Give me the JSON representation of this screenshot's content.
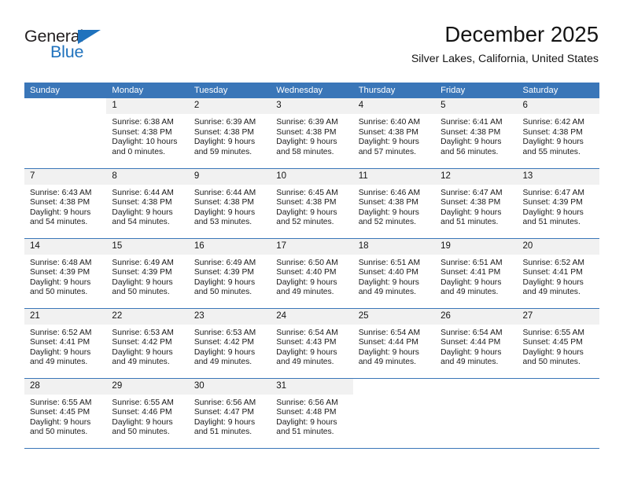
{
  "brand": {
    "name_part1": "General",
    "name_part2": "Blue",
    "triangle_color": "#1f72bd"
  },
  "header": {
    "title": "December 2025",
    "subtitle": "Silver Lakes, California, United States",
    "header_bg_color": "#3a76b8",
    "daynum_bg_color": "#f1f1f1"
  },
  "weekdays": [
    "Sunday",
    "Monday",
    "Tuesday",
    "Wednesday",
    "Thursday",
    "Friday",
    "Saturday"
  ],
  "weeks": [
    [
      {
        "day": "",
        "sunrise": "",
        "sunset": "",
        "daylight1": "",
        "daylight2": ""
      },
      {
        "day": "1",
        "sunrise": "Sunrise: 6:38 AM",
        "sunset": "Sunset: 4:38 PM",
        "daylight1": "Daylight: 10 hours",
        "daylight2": "and 0 minutes."
      },
      {
        "day": "2",
        "sunrise": "Sunrise: 6:39 AM",
        "sunset": "Sunset: 4:38 PM",
        "daylight1": "Daylight: 9 hours",
        "daylight2": "and 59 minutes."
      },
      {
        "day": "3",
        "sunrise": "Sunrise: 6:39 AM",
        "sunset": "Sunset: 4:38 PM",
        "daylight1": "Daylight: 9 hours",
        "daylight2": "and 58 minutes."
      },
      {
        "day": "4",
        "sunrise": "Sunrise: 6:40 AM",
        "sunset": "Sunset: 4:38 PM",
        "daylight1": "Daylight: 9 hours",
        "daylight2": "and 57 minutes."
      },
      {
        "day": "5",
        "sunrise": "Sunrise: 6:41 AM",
        "sunset": "Sunset: 4:38 PM",
        "daylight1": "Daylight: 9 hours",
        "daylight2": "and 56 minutes."
      },
      {
        "day": "6",
        "sunrise": "Sunrise: 6:42 AM",
        "sunset": "Sunset: 4:38 PM",
        "daylight1": "Daylight: 9 hours",
        "daylight2": "and 55 minutes."
      }
    ],
    [
      {
        "day": "7",
        "sunrise": "Sunrise: 6:43 AM",
        "sunset": "Sunset: 4:38 PM",
        "daylight1": "Daylight: 9 hours",
        "daylight2": "and 54 minutes."
      },
      {
        "day": "8",
        "sunrise": "Sunrise: 6:44 AM",
        "sunset": "Sunset: 4:38 PM",
        "daylight1": "Daylight: 9 hours",
        "daylight2": "and 54 minutes."
      },
      {
        "day": "9",
        "sunrise": "Sunrise: 6:44 AM",
        "sunset": "Sunset: 4:38 PM",
        "daylight1": "Daylight: 9 hours",
        "daylight2": "and 53 minutes."
      },
      {
        "day": "10",
        "sunrise": "Sunrise: 6:45 AM",
        "sunset": "Sunset: 4:38 PM",
        "daylight1": "Daylight: 9 hours",
        "daylight2": "and 52 minutes."
      },
      {
        "day": "11",
        "sunrise": "Sunrise: 6:46 AM",
        "sunset": "Sunset: 4:38 PM",
        "daylight1": "Daylight: 9 hours",
        "daylight2": "and 52 minutes."
      },
      {
        "day": "12",
        "sunrise": "Sunrise: 6:47 AM",
        "sunset": "Sunset: 4:38 PM",
        "daylight1": "Daylight: 9 hours",
        "daylight2": "and 51 minutes."
      },
      {
        "day": "13",
        "sunrise": "Sunrise: 6:47 AM",
        "sunset": "Sunset: 4:39 PM",
        "daylight1": "Daylight: 9 hours",
        "daylight2": "and 51 minutes."
      }
    ],
    [
      {
        "day": "14",
        "sunrise": "Sunrise: 6:48 AM",
        "sunset": "Sunset: 4:39 PM",
        "daylight1": "Daylight: 9 hours",
        "daylight2": "and 50 minutes."
      },
      {
        "day": "15",
        "sunrise": "Sunrise: 6:49 AM",
        "sunset": "Sunset: 4:39 PM",
        "daylight1": "Daylight: 9 hours",
        "daylight2": "and 50 minutes."
      },
      {
        "day": "16",
        "sunrise": "Sunrise: 6:49 AM",
        "sunset": "Sunset: 4:39 PM",
        "daylight1": "Daylight: 9 hours",
        "daylight2": "and 50 minutes."
      },
      {
        "day": "17",
        "sunrise": "Sunrise: 6:50 AM",
        "sunset": "Sunset: 4:40 PM",
        "daylight1": "Daylight: 9 hours",
        "daylight2": "and 49 minutes."
      },
      {
        "day": "18",
        "sunrise": "Sunrise: 6:51 AM",
        "sunset": "Sunset: 4:40 PM",
        "daylight1": "Daylight: 9 hours",
        "daylight2": "and 49 minutes."
      },
      {
        "day": "19",
        "sunrise": "Sunrise: 6:51 AM",
        "sunset": "Sunset: 4:41 PM",
        "daylight1": "Daylight: 9 hours",
        "daylight2": "and 49 minutes."
      },
      {
        "day": "20",
        "sunrise": "Sunrise: 6:52 AM",
        "sunset": "Sunset: 4:41 PM",
        "daylight1": "Daylight: 9 hours",
        "daylight2": "and 49 minutes."
      }
    ],
    [
      {
        "day": "21",
        "sunrise": "Sunrise: 6:52 AM",
        "sunset": "Sunset: 4:41 PM",
        "daylight1": "Daylight: 9 hours",
        "daylight2": "and 49 minutes."
      },
      {
        "day": "22",
        "sunrise": "Sunrise: 6:53 AM",
        "sunset": "Sunset: 4:42 PM",
        "daylight1": "Daylight: 9 hours",
        "daylight2": "and 49 minutes."
      },
      {
        "day": "23",
        "sunrise": "Sunrise: 6:53 AM",
        "sunset": "Sunset: 4:42 PM",
        "daylight1": "Daylight: 9 hours",
        "daylight2": "and 49 minutes."
      },
      {
        "day": "24",
        "sunrise": "Sunrise: 6:54 AM",
        "sunset": "Sunset: 4:43 PM",
        "daylight1": "Daylight: 9 hours",
        "daylight2": "and 49 minutes."
      },
      {
        "day": "25",
        "sunrise": "Sunrise: 6:54 AM",
        "sunset": "Sunset: 4:44 PM",
        "daylight1": "Daylight: 9 hours",
        "daylight2": "and 49 minutes."
      },
      {
        "day": "26",
        "sunrise": "Sunrise: 6:54 AM",
        "sunset": "Sunset: 4:44 PM",
        "daylight1": "Daylight: 9 hours",
        "daylight2": "and 49 minutes."
      },
      {
        "day": "27",
        "sunrise": "Sunrise: 6:55 AM",
        "sunset": "Sunset: 4:45 PM",
        "daylight1": "Daylight: 9 hours",
        "daylight2": "and 50 minutes."
      }
    ],
    [
      {
        "day": "28",
        "sunrise": "Sunrise: 6:55 AM",
        "sunset": "Sunset: 4:45 PM",
        "daylight1": "Daylight: 9 hours",
        "daylight2": "and 50 minutes."
      },
      {
        "day": "29",
        "sunrise": "Sunrise: 6:55 AM",
        "sunset": "Sunset: 4:46 PM",
        "daylight1": "Daylight: 9 hours",
        "daylight2": "and 50 minutes."
      },
      {
        "day": "30",
        "sunrise": "Sunrise: 6:56 AM",
        "sunset": "Sunset: 4:47 PM",
        "daylight1": "Daylight: 9 hours",
        "daylight2": "and 51 minutes."
      },
      {
        "day": "31",
        "sunrise": "Sunrise: 6:56 AM",
        "sunset": "Sunset: 4:48 PM",
        "daylight1": "Daylight: 9 hours",
        "daylight2": "and 51 minutes."
      },
      {
        "day": "",
        "sunrise": "",
        "sunset": "",
        "daylight1": "",
        "daylight2": ""
      },
      {
        "day": "",
        "sunrise": "",
        "sunset": "",
        "daylight1": "",
        "daylight2": ""
      },
      {
        "day": "",
        "sunrise": "",
        "sunset": "",
        "daylight1": "",
        "daylight2": ""
      }
    ]
  ]
}
